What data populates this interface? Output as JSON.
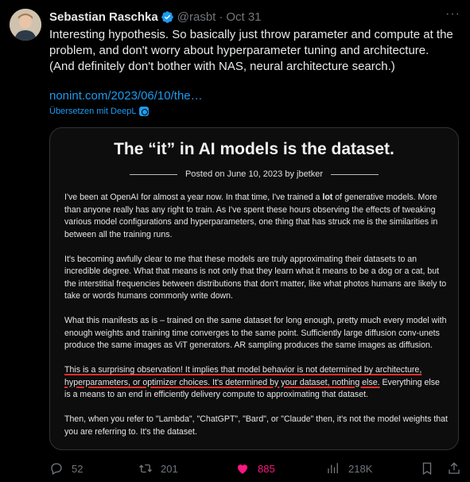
{
  "tweet": {
    "author_name": "Sebastian Raschka",
    "handle": "@rasbt",
    "separator": "·",
    "date": "Oct 31",
    "more_label": "···",
    "text": "Interesting hypothesis. So basically just throw parameter and compute at the problem, and don't worry about hyperparameter tuning and architecture.\n(And definitely don't bother with NAS, neural architecture search.)",
    "link": "nonint.com/2023/06/10/the…",
    "translate": "Übersetzen mit DeepL"
  },
  "card": {
    "title": "The “it” in AI models is the dataset.",
    "posted": "Posted on June 10, 2023 by jbetker",
    "p1_a": "I've been at OpenAI for almost a year now. In that time, I've trained a ",
    "p1_b": "lot",
    "p1_c": " of generative models. More than anyone really has any right to train. As I've spent these hours observing the effects of tweaking various model configurations and hyperparameters, one thing that has struck me is the similarities in between all the training runs.",
    "p2": "It's becoming awfully clear to me that these models are truly approximating their datasets to an incredible degree. What that means is not only that they learn what it means to be a dog or a cat, but the interstitial frequencies between distributions that don't matter, like what photos humans are likely to take or words humans commonly write down.",
    "p3": "What this manifests as is – trained on the same dataset for long enough, pretty much every model with enough weights and training time converges to the same point. Sufficiently large diffusion conv-unets produce the same images as ViT generators. AR sampling produces the same images as diffusion.",
    "p4_hl": "This is a surprising observation! It implies that model behavior is not determined by architecture, hyperparameters, or optimizer choices. It's determined by your dataset, nothing else.",
    "p4_rest": " Everything else is a means to an end in efficiently delivery compute to approximating that dataset.",
    "p5": "Then, when you refer to \"Lambda\", \"ChatGPT\", \"Bard\", or \"Claude\" then, it's not the model weights that you are referring to. It's the dataset."
  },
  "actions": {
    "replies": "52",
    "retweets": "201",
    "likes": "885",
    "views": "218K"
  },
  "colors": {
    "accent": "#1d9bf0",
    "like": "#f91880",
    "muted": "#71767b",
    "highlight": "#e0302a"
  }
}
